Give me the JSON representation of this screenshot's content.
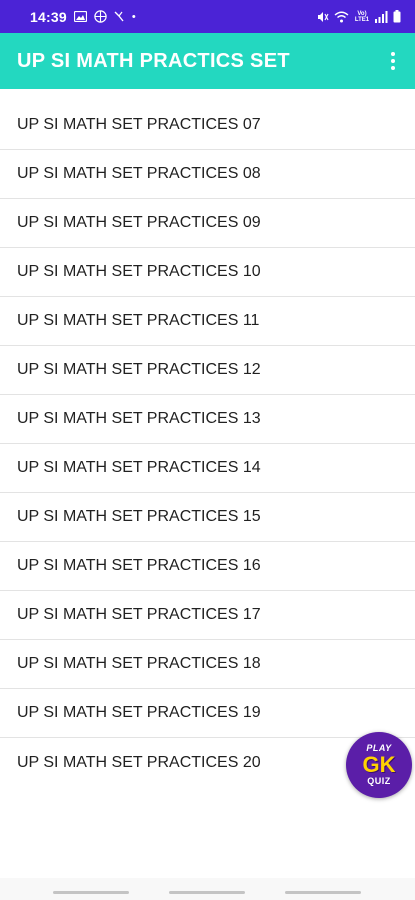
{
  "status_bar": {
    "time": "14:39",
    "left_icons": [
      "gallery-icon",
      "basketball-icon",
      "phone-icon"
    ],
    "dot": "•",
    "right_icons": [
      "mute-icon",
      "wifi-icon",
      "volte-icon",
      "signal-icon",
      "battery-icon"
    ],
    "volte_text": "Vo) LTE1"
  },
  "app_bar": {
    "title": "UP SI MATH PRACTICS SET",
    "background": "#23d8c0",
    "overflow_icon": "more-vert-icon"
  },
  "list": {
    "items": [
      "UP SI MATH SET PRACTICES 07",
      "UP SI MATH SET PRACTICES 08",
      "UP SI MATH SET PRACTICES 09",
      "UP SI MATH SET PRACTICES 10",
      "UP SI MATH SET PRACTICES 11",
      "UP SI MATH SET PRACTICES 12",
      "UP SI MATH SET PRACTICES 13",
      "UP SI MATH SET PRACTICES 14",
      "UP SI MATH SET PRACTICES 15",
      "UP SI MATH SET PRACTICES 16",
      "UP SI MATH SET PRACTICES 17",
      "UP SI MATH SET PRACTICES 18",
      "UP SI MATH SET PRACTICES 19",
      "UP SI MATH SET PRACTICES 20"
    ]
  },
  "fab": {
    "play": "PLAY",
    "gk": "GK",
    "quiz": "QUIZ",
    "color": "#5b1ea8"
  },
  "colors": {
    "status_bar": "#4b23d6",
    "accent": "#23d8c0"
  }
}
